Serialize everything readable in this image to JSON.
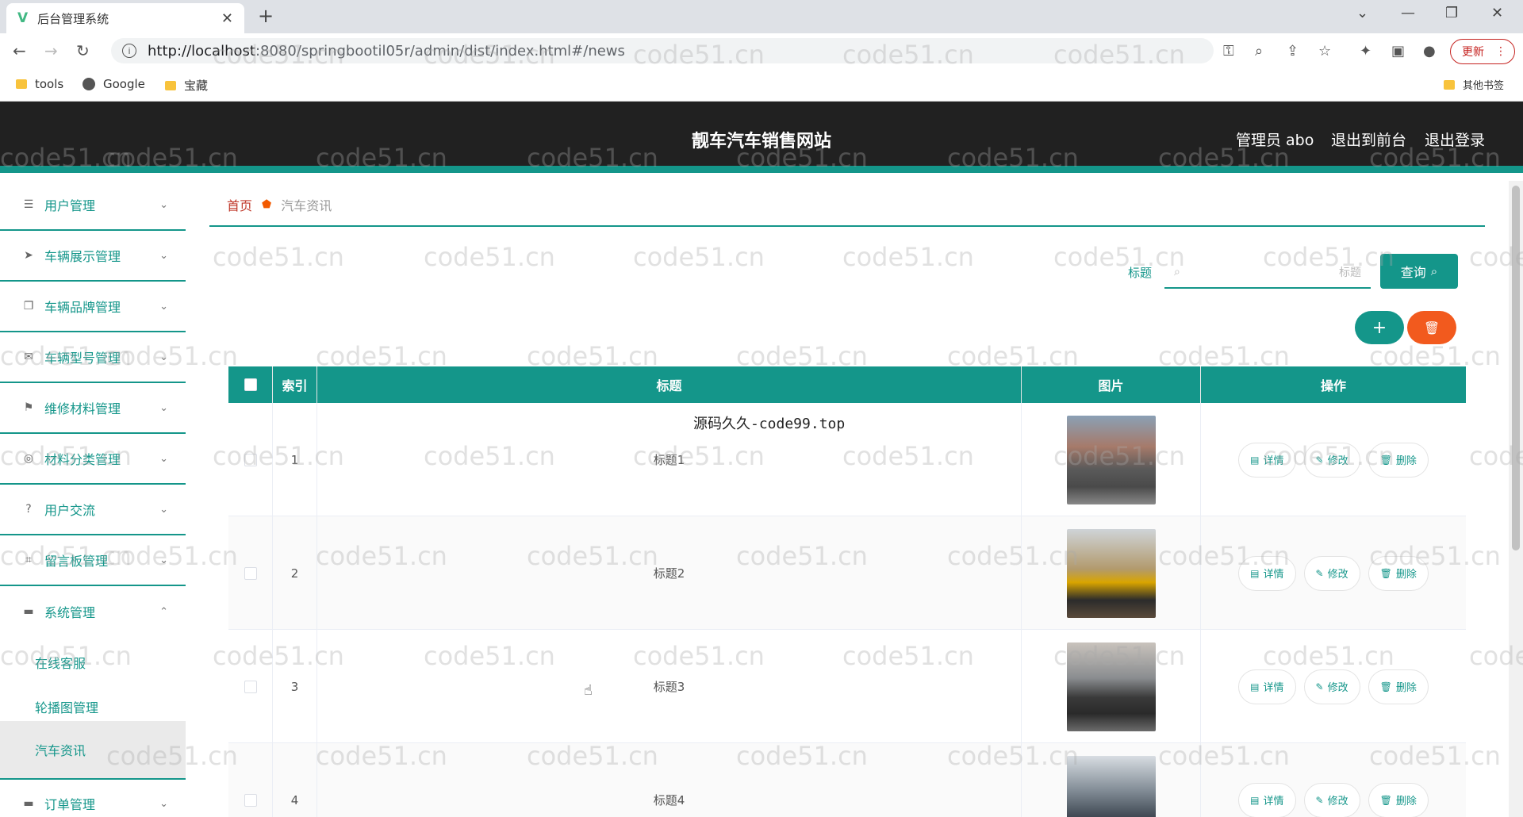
{
  "browser": {
    "tab_title": "后台管理系统",
    "url_host": "http://localhost",
    "url_path": ":8080/springbootil05r/admin/dist/index.html#/news",
    "update_label": "更新",
    "bookmarks": [
      {
        "label": "tools",
        "icon": "folder-icon"
      },
      {
        "label": "Google",
        "icon": "globe-icon"
      },
      {
        "label": "宝藏",
        "icon": "folder-icon"
      }
    ],
    "other_bookmarks": "其他书签"
  },
  "header": {
    "title": "靓车汽车销售网站",
    "admin": "管理员 abo",
    "front": "退出到前台",
    "logout": "退出登录"
  },
  "sidebar": {
    "items": [
      {
        "label": "用户管理",
        "icon": "list-icon"
      },
      {
        "label": "车辆展示管理",
        "icon": "send-icon"
      },
      {
        "label": "车辆品牌管理",
        "icon": "copy-icon"
      },
      {
        "label": "车辆型号管理",
        "icon": "mail-icon"
      },
      {
        "label": "维修材料管理",
        "icon": "flag-icon"
      },
      {
        "label": "材料分类管理",
        "icon": "compass-icon"
      },
      {
        "label": "用户交流",
        "icon": "help-icon"
      },
      {
        "label": "留言板管理",
        "icon": "crop-icon"
      },
      {
        "label": "系统管理",
        "icon": "chat-icon"
      }
    ],
    "sub_items": [
      "在线客服",
      "轮播图管理",
      "汽车资讯"
    ],
    "last_item": {
      "label": "订单管理",
      "icon": "monitor-icon"
    }
  },
  "breadcrumb": {
    "home": "首页",
    "current": "汽车资讯"
  },
  "search": {
    "label": "标题",
    "placeholder": "标题",
    "button": "查询"
  },
  "table": {
    "headers": {
      "index": "索引",
      "title": "标题",
      "image": "图片",
      "actions": "操作"
    },
    "rows": [
      {
        "index": "1",
        "title": "标题1"
      },
      {
        "index": "2",
        "title": "标题2"
      },
      {
        "index": "3",
        "title": "标题3"
      },
      {
        "index": "4",
        "title": "标题4"
      }
    ],
    "actions": {
      "detail": "详情",
      "edit": "修改",
      "delete": "删除"
    },
    "note": "源码久久-code99.top"
  },
  "watermark": "code51.cn",
  "colors": {
    "primary": "#14968a",
    "danger": "#f25a1e",
    "header_bg": "#212121"
  }
}
